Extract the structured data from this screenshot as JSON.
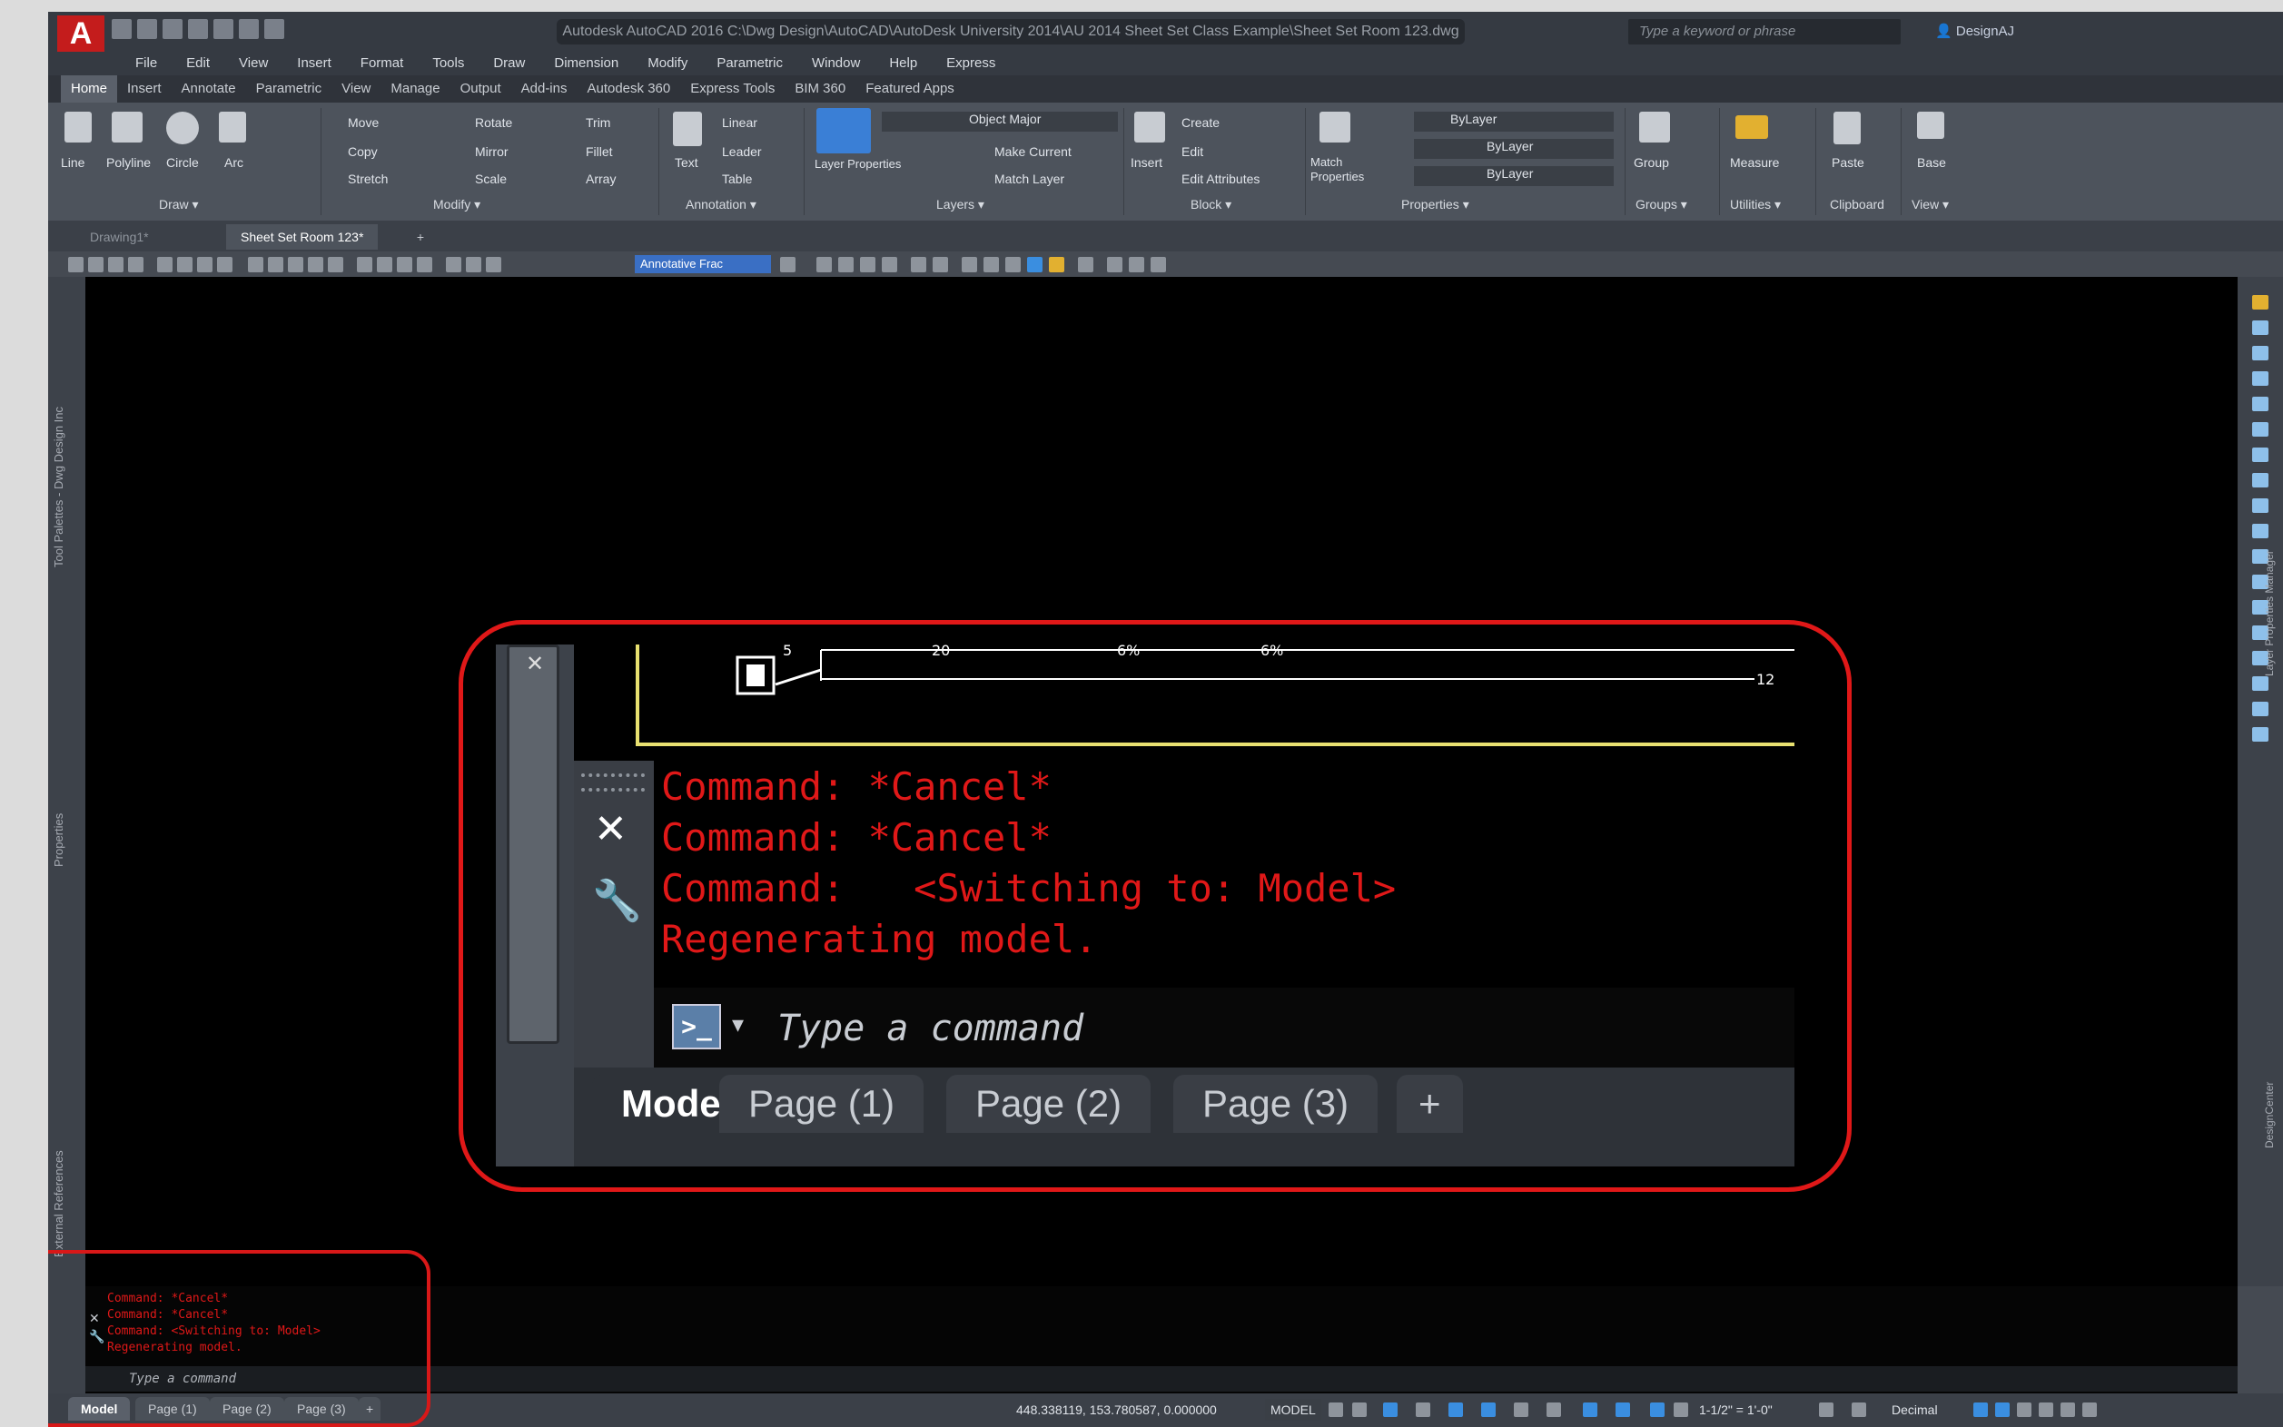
{
  "app": {
    "logo": "A",
    "window_title": "Autodesk AutoCAD 2016  C:\\Dwg Design\\AutoCAD\\AutoDesk University 2014\\AU 2014 Sheet Set Class Example\\Sheet Set Room 123.dwg",
    "search_placeholder": "Type a keyword or phrase",
    "user": "DesignAJ"
  },
  "menu": [
    "File",
    "Edit",
    "View",
    "Insert",
    "Format",
    "Tools",
    "Draw",
    "Dimension",
    "Modify",
    "Parametric",
    "Window",
    "Help",
    "Express"
  ],
  "ribbon_tabs": [
    {
      "label": "Home",
      "active": true
    },
    {
      "label": "Insert"
    },
    {
      "label": "Annotate"
    },
    {
      "label": "Parametric"
    },
    {
      "label": "View"
    },
    {
      "label": "Manage"
    },
    {
      "label": "Output"
    },
    {
      "label": "Add-ins"
    },
    {
      "label": "Autodesk 360"
    },
    {
      "label": "Express Tools"
    },
    {
      "label": "BIM 360"
    },
    {
      "label": "Featured Apps"
    }
  ],
  "ribbon": {
    "draw": {
      "line": "Line",
      "polyline": "Polyline",
      "circle": "Circle",
      "arc": "Arc",
      "panel": "Draw ▾"
    },
    "modify": {
      "move": "Move",
      "rotate": "Rotate",
      "trim": "Trim",
      "copy": "Copy",
      "mirror": "Mirror",
      "fillet": "Fillet",
      "stretch": "Stretch",
      "scale": "Scale",
      "array": "Array",
      "panel": "Modify ▾"
    },
    "annotation": {
      "text": "Text",
      "linear": "Linear",
      "leader": "Leader",
      "table": "Table",
      "panel": "Annotation ▾"
    },
    "layers": {
      "layer_properties": "Layer Properties",
      "current_layer": "Object Major",
      "make_current": "Make Current",
      "match_layer": "Match Layer",
      "panel": "Layers ▾"
    },
    "block": {
      "insert": "Insert",
      "create": "Create",
      "edit": "Edit",
      "edit_attributes": "Edit Attributes",
      "panel": "Block ▾"
    },
    "properties": {
      "match": "Match Properties",
      "color": "ByLayer",
      "linetype": "ByLayer",
      "lineweight": "ByLayer",
      "panel": "Properties ▾"
    },
    "groups": {
      "group": "Group",
      "panel": "Groups ▾"
    },
    "utilities": {
      "measure": "Measure",
      "panel": "Utilities ▾"
    },
    "clipboard": {
      "paste": "Paste",
      "panel": "Clipboard"
    },
    "view": {
      "base": "Base",
      "panel": "View ▾"
    }
  },
  "doc_tabs": [
    {
      "label": "Drawing1*"
    },
    {
      "label": "Sheet Set Room 123*",
      "active": true
    }
  ],
  "toolbar_annotative": "Annotative Frac",
  "side_labels": {
    "tool_palettes": "Tool Palettes - Dwg Design Inc",
    "properties": "Properties",
    "external_references": "External References",
    "layer_manager": "Layer Properties Manager",
    "design_center": "DesignCenter"
  },
  "command_history": [
    "Command: *Cancel*",
    "Command: *Cancel*",
    "Command:   <Switching to: Model>",
    "Regenerating model."
  ],
  "command_prompt": "Type a command",
  "layout_tabs": [
    "Model",
    "Page (1)",
    "Page (2)",
    "Page (3)"
  ],
  "status": {
    "coordinates": "448.338119, 153.780587, 0.000000",
    "space": "MODEL",
    "scale": "1-1/2\" = 1'-0\"",
    "units": "Decimal"
  },
  "zoom_drawing_labels": [
    "5",
    "20",
    "6%",
    "6%",
    "12"
  ],
  "colors": {
    "accent": "#e01818",
    "canvas": "#000000",
    "chrome": "#454a52"
  }
}
